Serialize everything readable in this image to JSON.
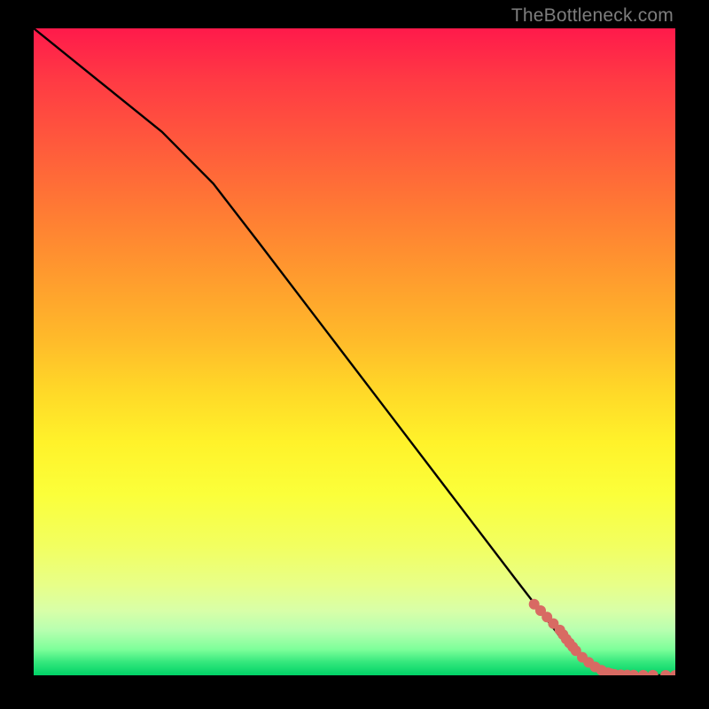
{
  "watermark": "TheBottleneck.com",
  "chart_data": {
    "type": "line",
    "title": "",
    "xlabel": "",
    "ylabel": "",
    "xlim": [
      0,
      100
    ],
    "ylim": [
      0,
      100
    ],
    "grid": false,
    "legend": false,
    "series": [
      {
        "name": "curve",
        "type": "line",
        "color": "#000000",
        "x": [
          0,
          10,
          20,
          28,
          35,
          45,
          55,
          65,
          75,
          82,
          88,
          92,
          96,
          100
        ],
        "y": [
          100,
          92,
          84,
          76,
          67,
          54,
          41,
          28,
          15,
          6,
          1,
          0,
          0,
          0
        ]
      },
      {
        "name": "points",
        "type": "scatter",
        "color": "#d86a63",
        "x": [
          78,
          79,
          80,
          81,
          82,
          82.5,
          83,
          83.5,
          84,
          84.5,
          85.5,
          86.5,
          87.5,
          88.5,
          89.5,
          90.0,
          90.5,
          91.5,
          92.5,
          93.5,
          95.0,
          96.5,
          98.5,
          100
        ],
        "y": [
          11,
          10,
          9,
          8,
          7,
          6.3,
          5.6,
          5.0,
          4.4,
          3.8,
          2.8,
          2.0,
          1.3,
          0.8,
          0.4,
          0.25,
          0.15,
          0.08,
          0.05,
          0.03,
          0.02,
          0.01,
          0.0,
          0.0
        ]
      }
    ]
  }
}
